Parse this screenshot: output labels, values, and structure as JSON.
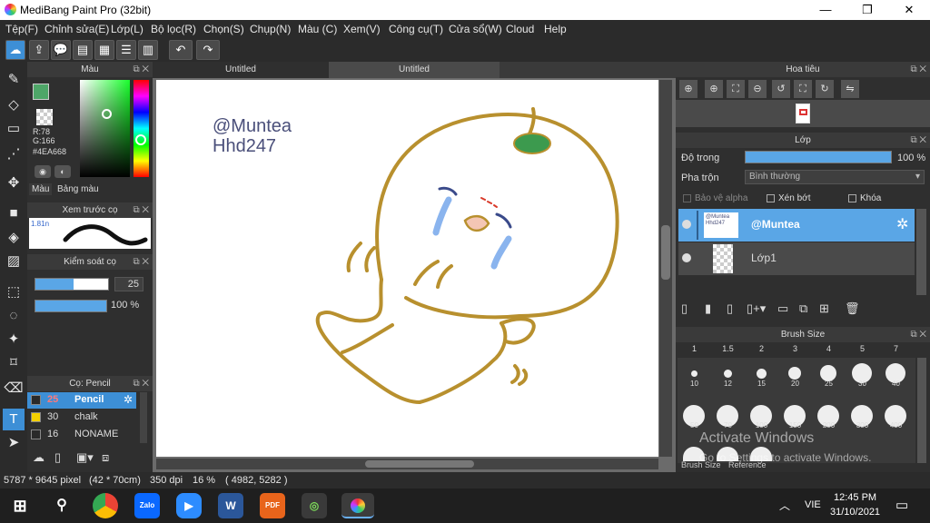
{
  "window": {
    "title": "MediBang Paint Pro (32bit)",
    "minimize": "—",
    "maximize": "❐",
    "close": "✕"
  },
  "menu": [
    "Tệp(F)",
    "Chỉnh sửa(E)",
    "Lớp(L)",
    "Bộ lọc(R)",
    "Chọn(S)",
    "Chụp(N)",
    "Màu (C)",
    "Xem(V)",
    "Công cụ(T)",
    "Cửa sổ(W)",
    "Cloud",
    "Help"
  ],
  "color_panel": {
    "title": "Màu",
    "r": "R:78",
    "g": "G:166",
    "hex": "#4EA668",
    "tab_color": "Màu",
    "tab_palette": "Bảng màu",
    "current_color": "#4EA668"
  },
  "brush_preview": {
    "title": "Xem trước cọ",
    "size": "1.81n"
  },
  "brush_control": {
    "title": "Kiểm soát cọ",
    "size_value": "25",
    "opacity_value": "100 %"
  },
  "brush_list": {
    "title": "Cọ: Pencil",
    "items": [
      {
        "size": "25",
        "name": "Pencil",
        "color": "#2a2a2a"
      },
      {
        "size": "30",
        "name": "chalk",
        "color": "#f4d000"
      },
      {
        "size": "16",
        "name": "NONAME",
        "color": "#2a2a2a"
      }
    ]
  },
  "doc_tabs": [
    "Untitled",
    "Untitled"
  ],
  "canvas_text": {
    "line1": "@Muntea",
    "line2": "Hhd247"
  },
  "navigator": {
    "title": "Hoa tiêu"
  },
  "layer_panel": {
    "title": "Lớp",
    "opacity_label": "Độ trong",
    "opacity_value": "100 %",
    "blend_label": "Pha trộn",
    "blend_value": "Bình thường",
    "protect_alpha": "Bảo vệ alpha",
    "clipping": "Xén bớt",
    "lock": "Khóa",
    "layers": [
      {
        "name": "@Muntea",
        "thumb": "@Muntea Hhd247"
      },
      {
        "name": "Lớp1",
        "thumb": ""
      }
    ]
  },
  "brush_size": {
    "title": "Brush Size",
    "header": [
      "1",
      "1.5",
      "2",
      "3",
      "4",
      "5",
      "7"
    ],
    "row1": [
      "10",
      "12",
      "15",
      "20",
      "25",
      "30",
      "40"
    ],
    "row2": [
      "50",
      "70",
      "100",
      "150",
      "200",
      "300",
      "400"
    ],
    "tab_size": "Brush Size",
    "tab_ref": "Reference"
  },
  "watermark": {
    "line1": "Activate Windows",
    "line2": "Go to Settings to activate Windows."
  },
  "status": {
    "dims": "5787 * 9645 pixel",
    "cm": "(42 * 70cm)",
    "dpi": "350 dpi",
    "zoom": "16 %",
    "coords": "( 4982, 5282 )"
  },
  "taskbar": {
    "time": "12:45 PM",
    "date": "31/10/2021",
    "lang": "VIE",
    "zalo": "Zalo"
  }
}
